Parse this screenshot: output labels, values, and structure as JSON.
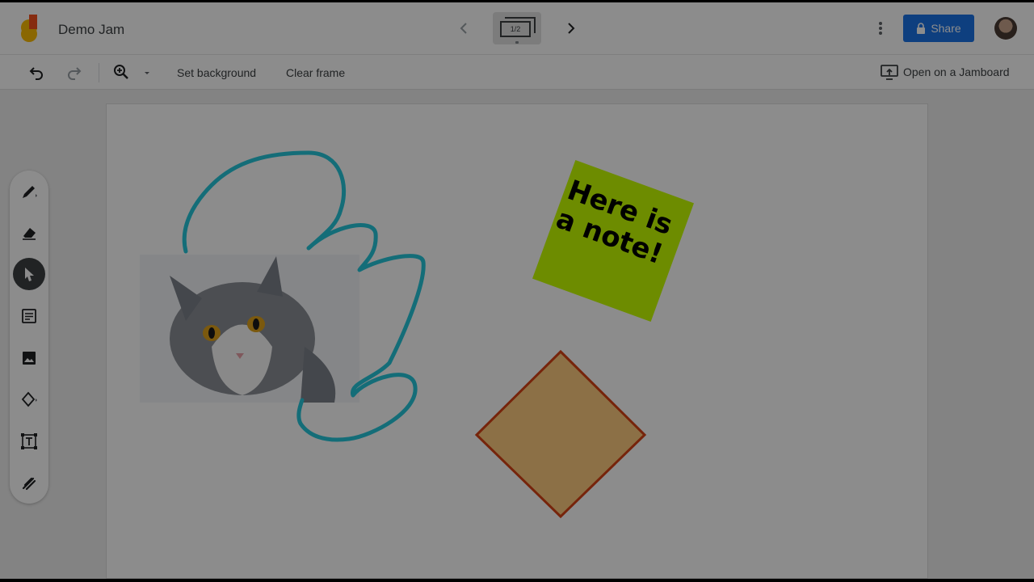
{
  "app": {
    "title": "Demo Jam",
    "logo_icon": "jamboard-logo-icon"
  },
  "frame_nav": {
    "counter": "1/2",
    "prev_icon": "chevron-left-icon",
    "next_icon": "chevron-right-icon"
  },
  "header_actions": {
    "share_label": "Share",
    "share_icon": "lock-icon",
    "more_icon": "more-vert-icon",
    "avatar_icon": "user-avatar"
  },
  "toolbar": {
    "undo_icon": "undo-icon",
    "redo_icon": "redo-icon",
    "zoom_icon": "zoom-icon",
    "set_background": "Set background",
    "clear_frame": "Clear frame",
    "open_on_jamboard": "Open on a Jamboard"
  },
  "tools": [
    {
      "name": "pen-tool",
      "icon": "pen-icon",
      "active": false
    },
    {
      "name": "eraser-tool",
      "icon": "eraser-icon",
      "active": false
    },
    {
      "name": "select-tool",
      "icon": "cursor-icon",
      "active": true
    },
    {
      "name": "sticky-note-tool",
      "icon": "note-icon",
      "active": false
    },
    {
      "name": "image-tool",
      "icon": "image-icon",
      "active": false
    },
    {
      "name": "shape-tool",
      "icon": "diamond-icon",
      "active": false
    },
    {
      "name": "text-box-tool",
      "icon": "text-box-icon",
      "active": false
    },
    {
      "name": "laser-tool",
      "icon": "laser-icon",
      "active": false
    }
  ],
  "canvas": {
    "sticky_note_line1": "Here is",
    "sticky_note_line2": "a note!",
    "sticky_color": "#c6ff00",
    "drawing_color": "#26c6da",
    "diamond_fill": "#ffcc80",
    "diamond_stroke": "#d84315",
    "image_label": "cat photo"
  },
  "colors": {
    "accent": "#1a73e8"
  }
}
